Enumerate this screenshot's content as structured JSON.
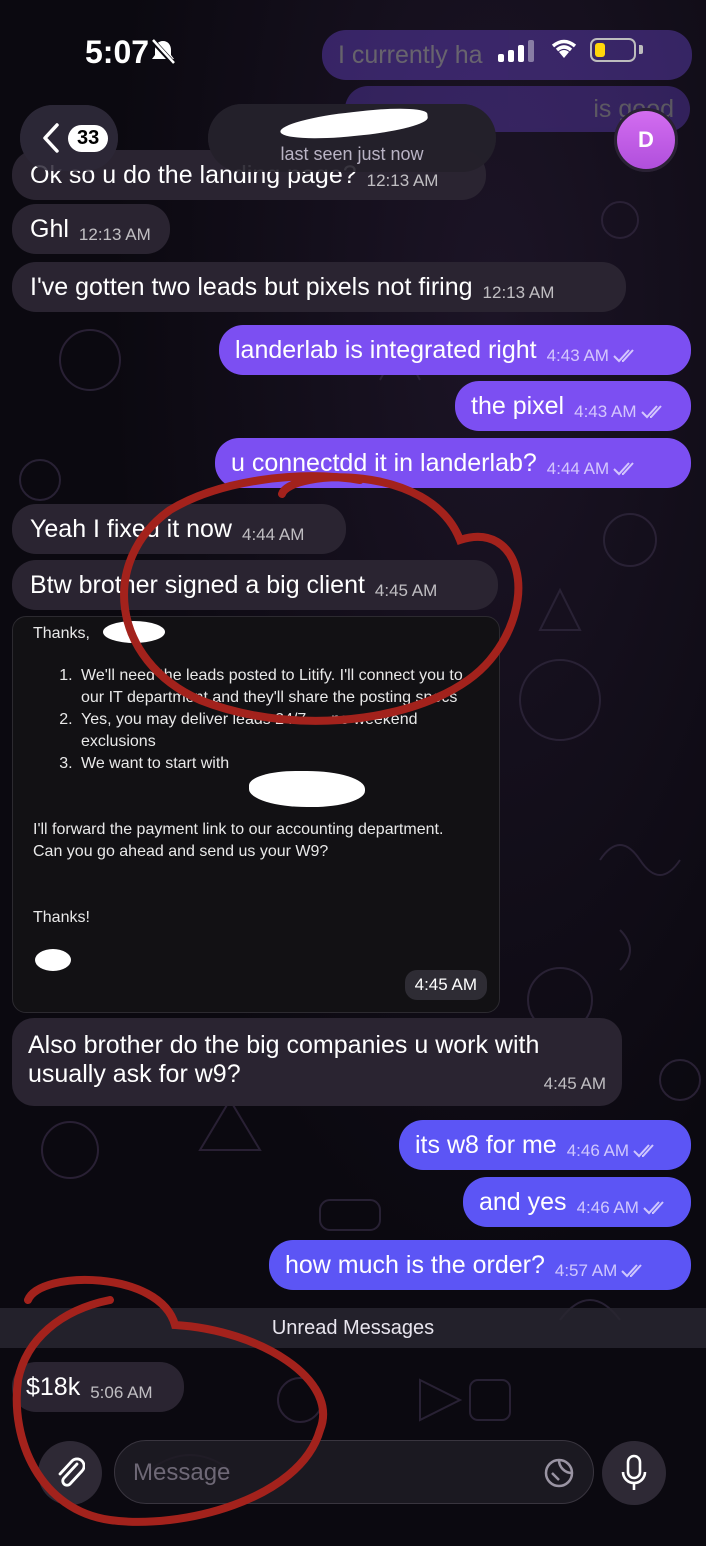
{
  "status_bar": {
    "time": "5:07"
  },
  "header": {
    "back_count": "33",
    "status": "last seen just now",
    "avatar_initial": "D"
  },
  "ghost_bubbles": [
    "I currently ha",
    "is good"
  ],
  "messages": [
    {
      "text": "Ok so u do the landing page?",
      "time": "12:13 AM",
      "dir": "in"
    },
    {
      "text": "Ghl",
      "time": "12:13 AM",
      "dir": "in"
    },
    {
      "text": "I've gotten two leads but pixels not firing",
      "time": "12:13 AM",
      "dir": "in"
    },
    {
      "text": "landerlab is integrated right",
      "time": "4:43 AM",
      "dir": "out"
    },
    {
      "text": "the pixel",
      "time": "4:43 AM",
      "dir": "out"
    },
    {
      "text": "u connectdd it in landerlab?",
      "time": "4:44 AM",
      "dir": "out"
    },
    {
      "text": "Yeah I fixed it now",
      "time": "4:44 AM",
      "dir": "in"
    },
    {
      "text": "Btw brother signed a big client",
      "time": "4:45 AM",
      "dir": "in"
    },
    {
      "text": "Also brother do the big companies u work with",
      "text2": "usually ask for w9?",
      "time": "4:45 AM",
      "dir": "in"
    },
    {
      "text": "its w8 for me",
      "time": "4:46 AM",
      "dir": "out"
    },
    {
      "text": "and yes",
      "time": "4:46 AM",
      "dir": "out"
    },
    {
      "text": "how much is the order?",
      "time": "4:57 AM",
      "dir": "out"
    },
    {
      "text": "$18k",
      "time": "5:06 AM",
      "dir": "in"
    }
  ],
  "email": {
    "greeting": "Thanks,",
    "items": [
      "We'll need the leads posted to Litify.  I'll connect you to our IT department and they'll share the posting specs",
      "Yes, you may deliver leads 24/7 — no weekend exclusions",
      "We want to start with"
    ],
    "paragraph": "I'll forward the payment link to our accounting department.  Can you go ahead and send us your W9?",
    "signoff": "Thanks!",
    "time": "4:45 AM"
  },
  "unread_label": "Unread Messages",
  "composer": {
    "placeholder": "Message"
  },
  "colors": {
    "outgoing": "#7c4ff2",
    "outgoing_blue": "#5c55f5",
    "incoming": "#2a2431",
    "annotation": "#a3221c"
  }
}
